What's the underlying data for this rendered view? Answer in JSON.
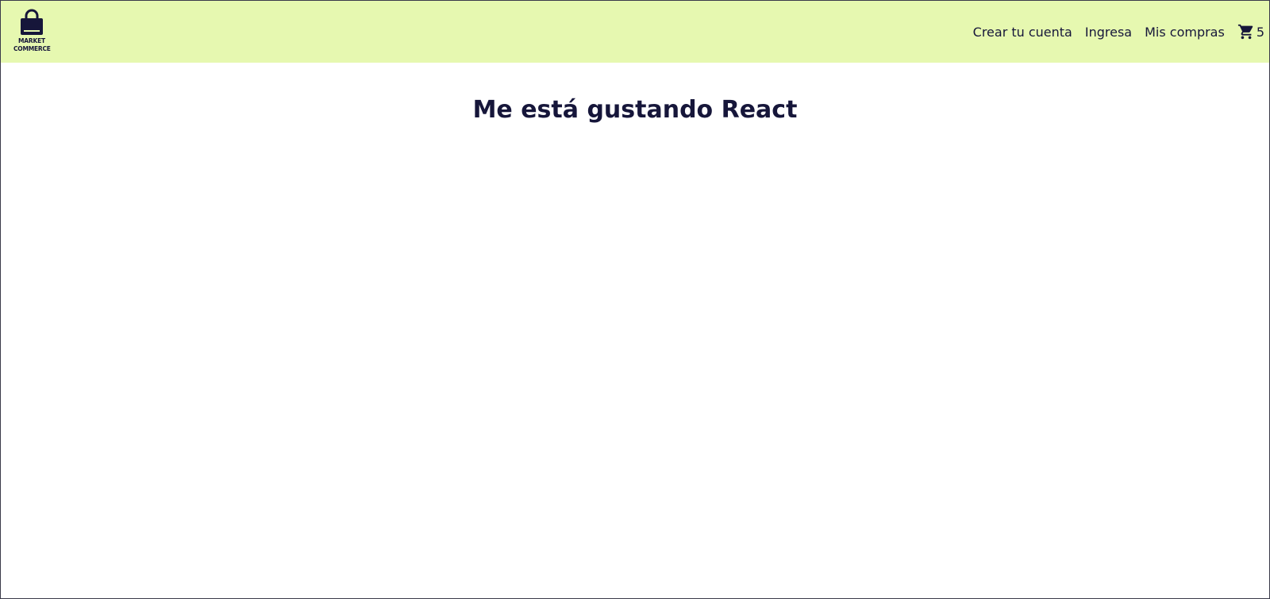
{
  "navbar": {
    "logo": {
      "icon": "shopping-bag-icon",
      "line1": "MARKET",
      "line2": "COMMERCE"
    },
    "links": {
      "create_account": "Crear tu cuenta",
      "login": "Ingresa",
      "purchases": "Mis compras"
    },
    "cart": {
      "icon": "cart-icon",
      "count": "5"
    },
    "background_color": "#e6f8b0",
    "text_color": "#16163a"
  },
  "main": {
    "title": "Me está gustando React"
  }
}
